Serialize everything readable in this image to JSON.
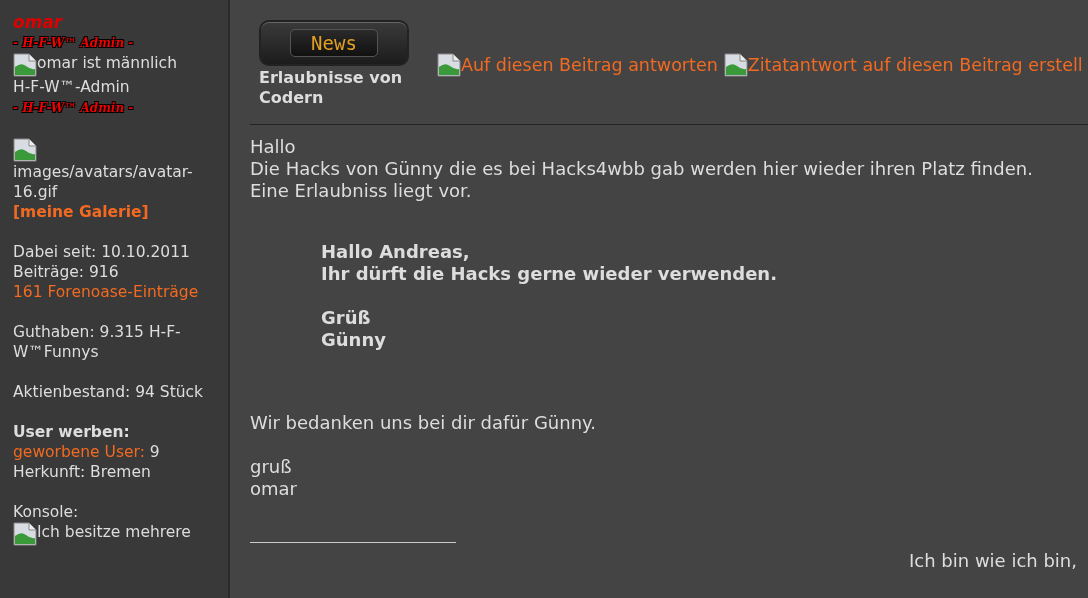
{
  "sidebar": {
    "username": "omar",
    "rank_images": [
      "- H-F-W™ Admin -",
      "- H-F-W™ Admin -"
    ],
    "gender_alt": "omar ist männlich",
    "rank_title": "H-F-W™-Admin",
    "avatar_alt": "images/avatars/avatar-16.gif",
    "gallery_link": "[meine Galerie]",
    "groups": [
      [
        {
          "kind": "text",
          "text": "Dabei seit: 10.10.2011"
        },
        {
          "kind": "text",
          "text": "Beiträge: 916"
        },
        {
          "kind": "link",
          "text": "161 Forenoase-Einträge"
        }
      ],
      [
        {
          "kind": "text",
          "text": "Guthaben: 9.315 H-F-W™Funnys"
        }
      ],
      [
        {
          "kind": "text",
          "text": "Aktienbestand: 94 Stück"
        }
      ],
      [
        {
          "kind": "heading",
          "text": "User werben:"
        },
        {
          "kind": "pair",
          "label": "geworbene User:",
          "value": "9"
        },
        {
          "kind": "text",
          "text": "Herkunft: Bremen"
        }
      ],
      [
        {
          "kind": "text",
          "text": "Konsole:"
        },
        {
          "kind": "image",
          "text": "Ich besitze mehrere"
        }
      ]
    ]
  },
  "post": {
    "badge": "News",
    "title": "Erlaubnisse von Codern",
    "actions": [
      "Auf diesen Beitrag antworten",
      "Zitatantwort auf diesen Beitrag erstell"
    ],
    "blocks": [
      {
        "kind": "para",
        "paras": [
          [
            "Hallo",
            "Die Hacks von Günny die es bei Hacks4wbb gab werden hier wieder ihren Platz finden.",
            "Eine Erlaubniss liegt vor."
          ]
        ]
      },
      {
        "kind": "quote",
        "paras": [
          [
            "Hallo Andreas,",
            "Ihr dürft die Hacks gerne wieder verwenden."
          ],
          [
            "Grüß",
            "Günny"
          ]
        ]
      },
      {
        "kind": "para",
        "paras": [
          [
            "Wir bedanken uns bei dir dafür Günny."
          ],
          [
            "gruß",
            "omar"
          ]
        ]
      }
    ],
    "signature": "Ich bin wie ich bin,"
  }
}
